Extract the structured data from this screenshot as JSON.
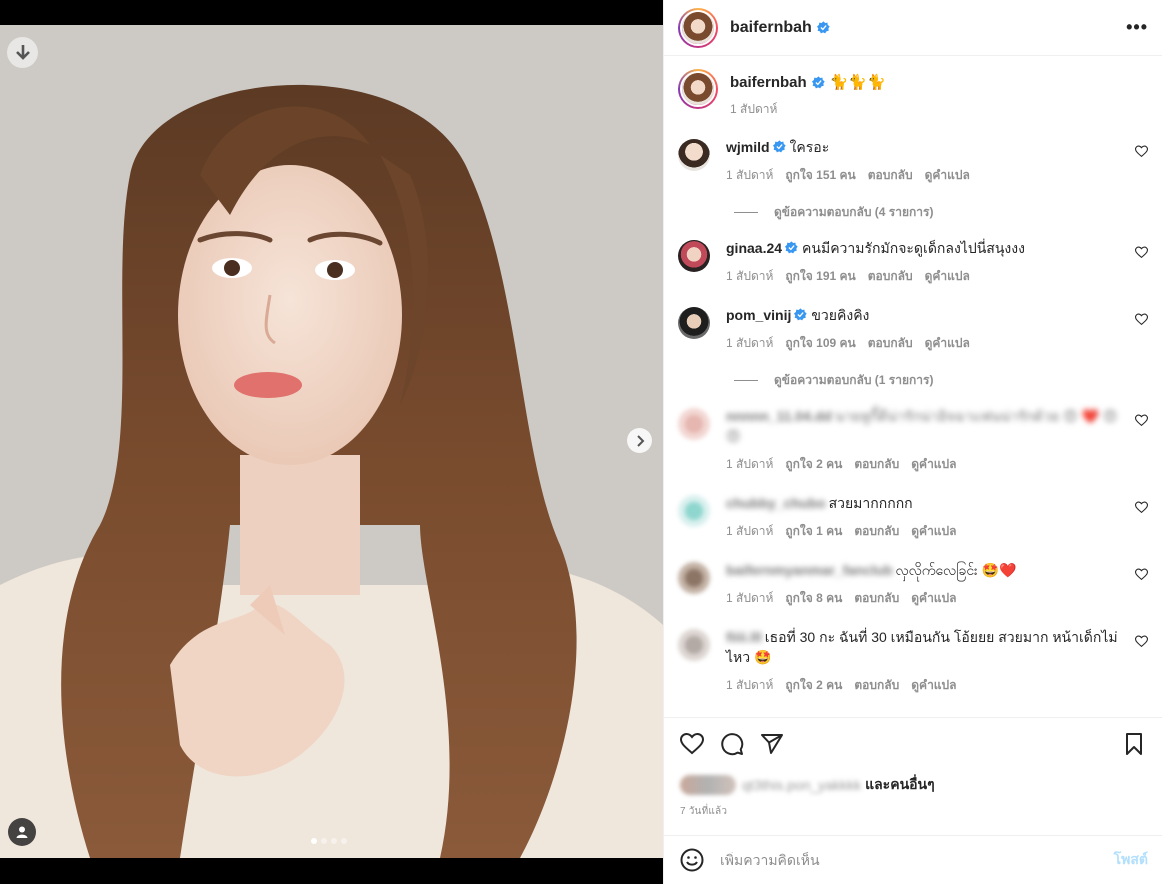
{
  "media": {
    "dot_count": 4,
    "active_dot": 1
  },
  "header": {
    "username": "baifernbah",
    "verified": true,
    "more_label": "•••"
  },
  "caption": {
    "username": "baifernbah",
    "text": "🐈🐈🐈",
    "time": "1 สัปดาห์"
  },
  "comments": [
    {
      "username": "wjmild",
      "verified": true,
      "text": "ใครอะ",
      "time": "1 สัปดาห์",
      "likes": "ถูกใจ 151 คน",
      "reply": "ตอบกลับ",
      "translate": "ดูคำแปล",
      "view_replies": "ดูข้อความตอบกลับ (4 รายการ)"
    },
    {
      "username": "ginaa.24",
      "verified": true,
      "text": "คนมีความรักมักจะดูเด็กลงไปนี่สนุงงง",
      "time": "1 สัปดาห์",
      "likes": "ถูกใจ 191 คน",
      "reply": "ตอบกลับ",
      "translate": "ดูคำแปล"
    },
    {
      "username": "pom_vinij",
      "verified": true,
      "text": "ขวยคิงคิง",
      "time": "1 สัปดาห์",
      "likes": "ถูกใจ 109 คน",
      "reply": "ตอบกลับ",
      "translate": "ดูคำแปล",
      "view_replies": "ดูข้อความตอบกลับ (1 รายการ)"
    },
    {
      "username": "nnnnn_11.04.dd",
      "verified": false,
      "text": "นายหูกี้ดีน่ารักน่าอิจฉาแฟนน่ารักด้วย 😍 ❤️ 😍😍",
      "time": "1 สัปดาห์",
      "likes": "ถูกใจ 2 คน",
      "reply": "ตอบกลับ",
      "translate": "ดูคำแปล"
    },
    {
      "username": "chubby_chubo",
      "verified": false,
      "text": "สวยมากกกกก",
      "time": "1 สัปดาห์",
      "likes": "ถูกใจ 1 คน",
      "reply": "ตอบกลับ",
      "translate": "ดูคำแปล"
    },
    {
      "username": "baifernmyanmar_fanclub",
      "verified": false,
      "text": "လှလိုက်လေခြင်း 🤩❤️",
      "time": "1 สัปดาห์",
      "likes": "ถูกใจ 8 คน",
      "reply": "ตอบกลับ",
      "translate": "ดูคำแปล"
    },
    {
      "username": "fiiii.lll",
      "verified": false,
      "text": "เธอที่ 30 กะ ฉันที่ 30 เหมือนกัน โอ้ยยย สวยมาก หน้าเด็กไม่ไหว 🤩",
      "time": "1 สัปดาห์",
      "likes": "ถูกใจ 2 คน",
      "reply": "ตอบกลับ",
      "translate": "ดูคำแปล"
    }
  ],
  "likes": {
    "names": "qt3this.pon_yakkkk",
    "and_others": "และคนอื่นๆ"
  },
  "posted_ago": "7 วันที่แล้ว",
  "composer": {
    "placeholder": "เพิ่มความคิดเห็น",
    "post_label": "โพสต์"
  },
  "colors": {
    "verified": "#3897f0",
    "secondary_text": "#8e8e8e",
    "post_disabled": "#b2dffc",
    "heart_red": "#ed4956"
  }
}
